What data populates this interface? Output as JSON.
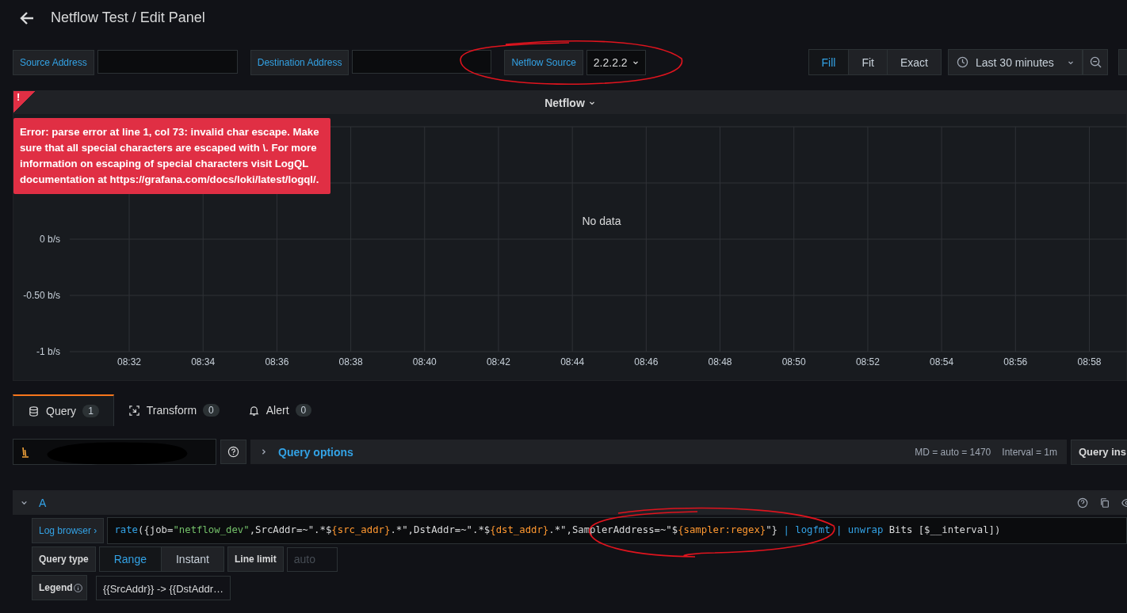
{
  "header": {
    "title": "Netflow Test / Edit Panel"
  },
  "variables": [
    {
      "label": "Source Address",
      "kind": "textbox"
    },
    {
      "label": "Destination Address",
      "kind": "textbox"
    },
    {
      "label": "Netflow Source",
      "kind": "dropdown",
      "value": "2.2.2.2"
    }
  ],
  "view_modes": [
    {
      "label": "Fill",
      "selected": true
    },
    {
      "label": "Fit",
      "selected": false
    },
    {
      "label": "Exact",
      "selected": false
    }
  ],
  "time_range": "Last 30 minutes",
  "panel": {
    "title": "Netflow",
    "error_mark": "!",
    "error": "Error: parse error at line 1, col 73: invalid char escape. Make sure that all special characters are escaped with \\. For more information on escaping of special characters visit LogQL documentation at https://grafana.com/docs/loki/latest/logql/.",
    "no_data": "No data",
    "chart_data": {
      "type": "line",
      "ylim": [
        -1,
        1
      ],
      "grid": true,
      "categories": [
        "08:32",
        "08:34",
        "08:36",
        "08:38",
        "08:40",
        "08:42",
        "08:44",
        "08:46",
        "08:48",
        "08:50",
        "08:52",
        "08:54",
        "08:56",
        "08:58"
      ],
      "yticks": [
        {
          "value": -1,
          "label": "-1 b/s"
        },
        {
          "value": -0.5,
          "label": "-0.50 b/s"
        },
        {
          "value": 0,
          "label": "0 b/s"
        }
      ]
    }
  },
  "tabs": [
    {
      "label": "Query",
      "count": "1",
      "kind": "query",
      "selected": true
    },
    {
      "label": "Transform",
      "count": "0",
      "kind": "transform",
      "selected": false
    },
    {
      "label": "Alert",
      "count": "0",
      "kind": "alert",
      "selected": false
    }
  ],
  "query_bar": {
    "options_label": "Query options",
    "md": "MD = auto = 1470",
    "interval": "Interval = 1m",
    "inspector": "Query ins"
  },
  "query": {
    "ref": "A",
    "browser_label": "Log browser ›",
    "tokens": [
      {
        "text": "rate",
        "kind": "function"
      },
      {
        "text": "({job=",
        "kind": "plain"
      },
      {
        "text": "\"netflow_dev\"",
        "kind": "string"
      },
      {
        "text": ",SrcAddr=~\".*$",
        "kind": "plain"
      },
      {
        "text": "{src_addr}",
        "kind": "variable"
      },
      {
        "text": ".*\",DstAddr=~\".*$",
        "kind": "plain"
      },
      {
        "text": "{dst_addr}",
        "kind": "variable"
      },
      {
        "text": ".*\",SamplerAddress=~\"$",
        "kind": "plain"
      },
      {
        "text": "{sampler:regex}",
        "kind": "variable"
      },
      {
        "text": "\"} ",
        "kind": "plain"
      },
      {
        "text": "| logfmt | unwrap",
        "kind": "function"
      },
      {
        "text": " Bits [$__interval])",
        "kind": "plain"
      }
    ],
    "query_type_label": "Query type",
    "query_types": [
      {
        "label": "Range",
        "selected": true
      },
      {
        "label": "Instant",
        "selected": false
      }
    ],
    "line_limit_label": "Line limit",
    "line_limit_placeholder": "auto",
    "legend_label": "Legend",
    "legend_value": "{{SrcAddr}} -> {{DstAddr…"
  }
}
